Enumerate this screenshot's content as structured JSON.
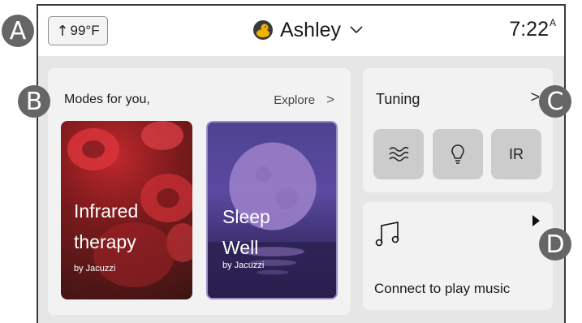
{
  "header": {
    "temperature": "99°F",
    "temperature_arrow": "↑",
    "user_name": "Ashley",
    "time": "7:22",
    "time_suffix": "A"
  },
  "modes": {
    "title": "Modes for you,",
    "explore_label": "Explore",
    "explore_chevron": ">",
    "tiles": [
      {
        "title_line1": "Infrared",
        "title_line2": "therapy",
        "by": "by Jacuzzi"
      },
      {
        "title_line1": "Sleep",
        "title_line2": "Well",
        "by": "by Jacuzzi"
      }
    ]
  },
  "tuning": {
    "title": "Tuning",
    "chevron": ">",
    "buttons": [
      {
        "icon": "air-waves-icon"
      },
      {
        "icon": "lightbulb-icon"
      },
      {
        "label": "IR"
      }
    ]
  },
  "music": {
    "icon": "music-note-icon",
    "label": "Connect to play music"
  },
  "markers": [
    "A",
    "B",
    "C",
    "D"
  ],
  "colors": {
    "background": "#e6e6e6",
    "card": "#f2f2f2",
    "button": "#cccccc",
    "marker": "#666666"
  }
}
